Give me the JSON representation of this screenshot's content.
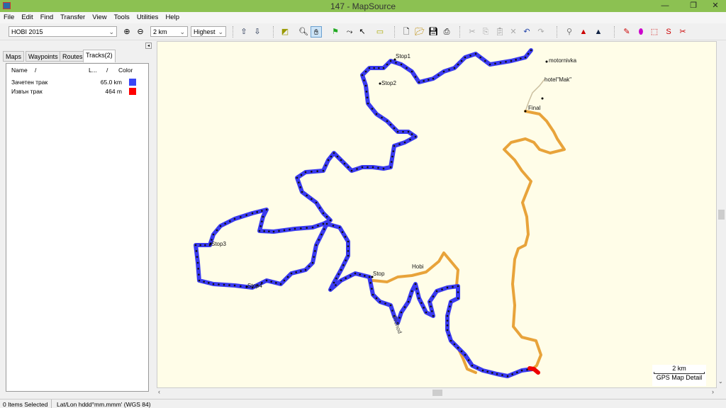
{
  "window": {
    "title": "147 - MapSource"
  },
  "menu": [
    "File",
    "Edit",
    "Find",
    "Transfer",
    "View",
    "Tools",
    "Utilities",
    "Help"
  ],
  "toolbar": {
    "map_product": "HOBI 2015",
    "zoom_scale": "2 km",
    "detail": "Highest"
  },
  "tabs": [
    "Maps",
    "Waypoints",
    "Routes",
    "Tracks(2)"
  ],
  "tracks": {
    "headers": {
      "name": "Name",
      "length": "L...",
      "color": "Color",
      "sort": "/"
    },
    "rows": [
      {
        "name": "Зачетен трак",
        "length": "65.0 km",
        "color": "#3a46f5"
      },
      {
        "name": "Извън трак",
        "length": "464 m",
        "color": "#ff0000"
      }
    ]
  },
  "map": {
    "labels": {
      "stop1": "Stop1",
      "stop2": "Stop2",
      "stop3": "Stop3",
      "stop4": "Stop4",
      "stop": "Stop",
      "hobi": "Hobi",
      "motornivka": "motornivka",
      "hotel": "hotel\"Mak\"",
      "final": "Final",
      "road": "Prohod"
    },
    "scale_label": "2 km",
    "detail_label": "GPS Map Detail",
    "colors": {
      "track": "#3a3af0",
      "route": "#e8a33a",
      "extra": "#ee0000",
      "background": "#fffde8"
    }
  },
  "status": {
    "selection": "0 Items Selected",
    "format": "Lat/Lon hddd°mm.mmm' (WGS 84)"
  }
}
